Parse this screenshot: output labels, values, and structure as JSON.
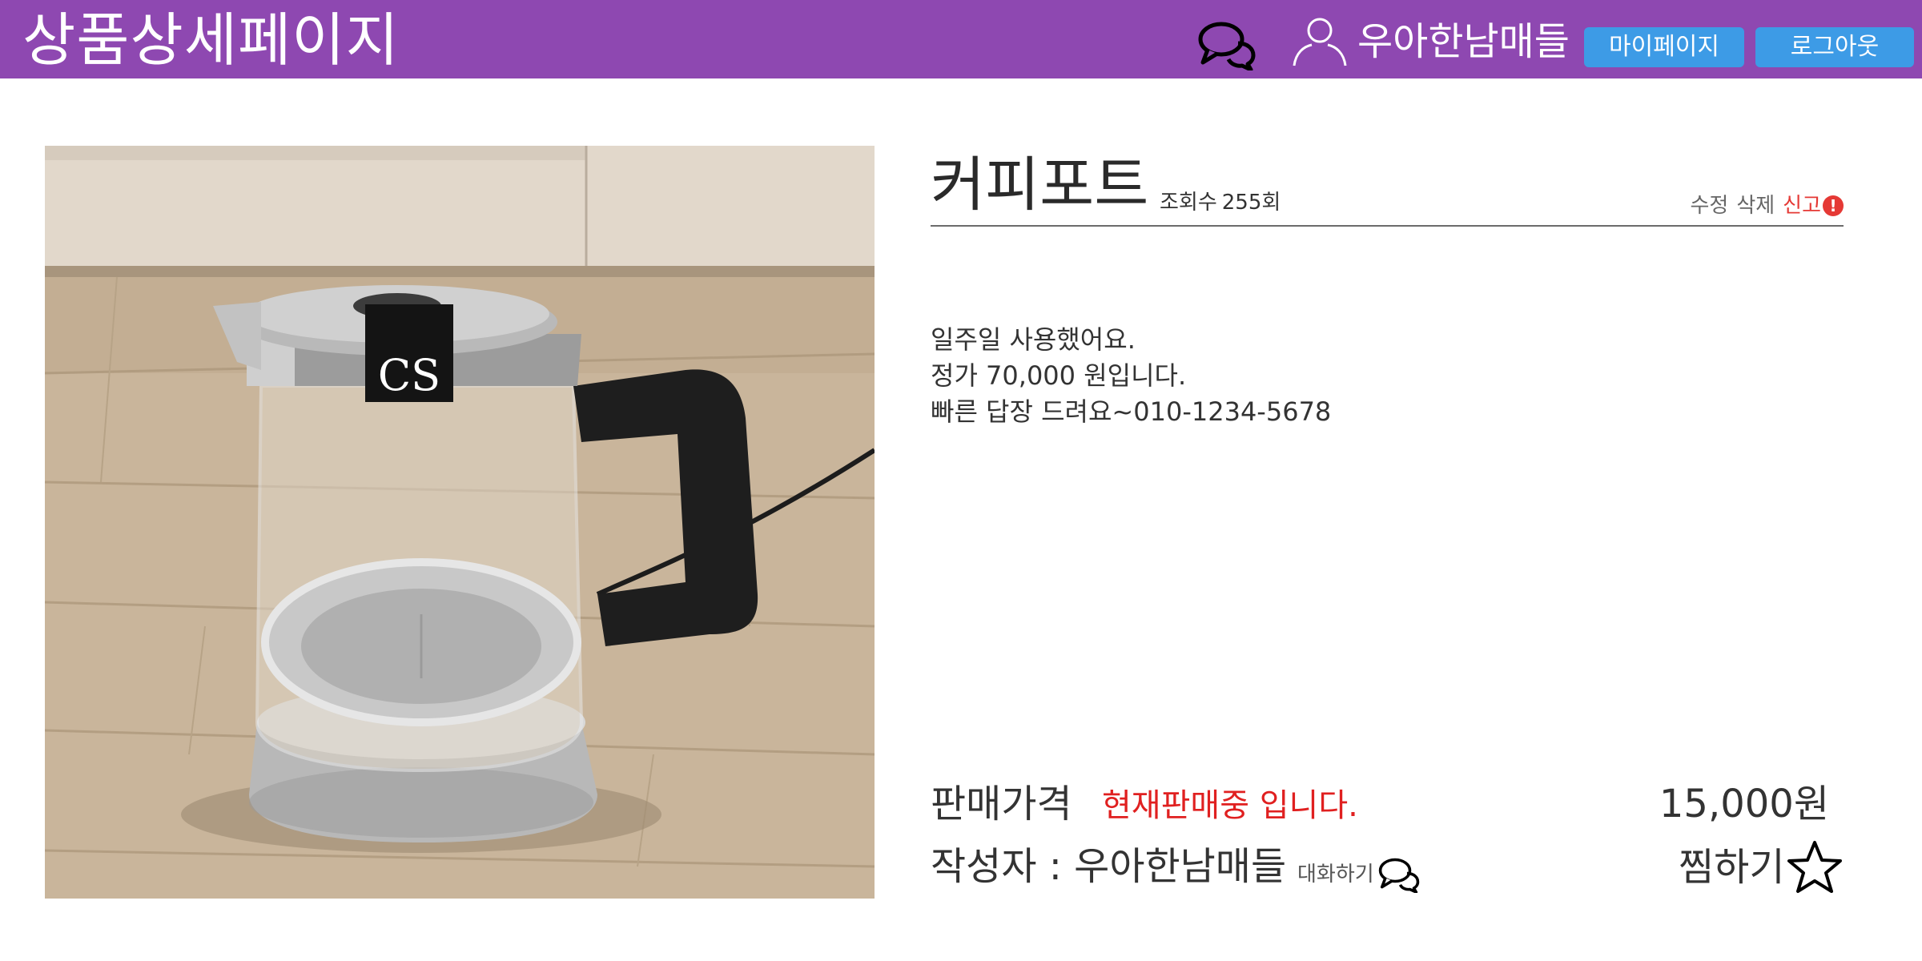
{
  "header": {
    "title": "상품상세페이지",
    "username": "우아한남매들",
    "mypage_label": "마이페이지",
    "logout_label": "로그아웃",
    "accent_color": "#8e48b1",
    "button_color": "#3d9be6",
    "icons": [
      "chat-icon",
      "user-icon"
    ]
  },
  "product": {
    "title": "커피포트",
    "views_label": "조회수",
    "views_value": "255회",
    "edit_label": "수정",
    "delete_label": "삭제",
    "report_label": "신고",
    "report_badge": "!",
    "description": [
      "일주일 사용했어요.",
      "정가 70,000 원입니다.",
      "빠른 답장 드려요~010-1234-5678"
    ],
    "price_label": "판매가격",
    "status": "현재판매중 입니다.",
    "price": "15,000원",
    "author_line": "작성자 : 우아한남매들",
    "chat_label": "대화하기",
    "wish_label": "찜하기",
    "image": {
      "subject": "glass electric kettle",
      "brand_mark": "CS"
    },
    "status_color": "#e02020",
    "report_color": "#e53935"
  }
}
